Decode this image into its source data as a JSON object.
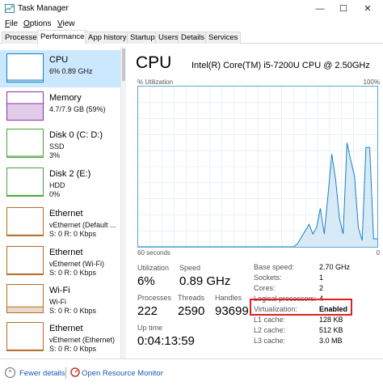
{
  "window": {
    "title": "Task Manager",
    "controls": {
      "minimize": "—",
      "maximize": "☐",
      "close": "✕"
    }
  },
  "menu": [
    {
      "hot": "F",
      "rest": "ile"
    },
    {
      "hot": "O",
      "rest": "ptions"
    },
    {
      "hot": "V",
      "rest": "iew"
    }
  ],
  "tabs": [
    "Processes",
    "Performance",
    "App history",
    "Startup",
    "Users",
    "Details",
    "Services"
  ],
  "active_tab": "Performance",
  "sidebar": [
    {
      "name": "CPU",
      "line1": "6%  0.89 GHz",
      "line2": "",
      "color": "#1581c3",
      "fill": 0.06
    },
    {
      "name": "Memory",
      "line1": "4.7/7.9 GB (59%)",
      "line2": "",
      "color": "#8b2fa8",
      "fill": 0.59
    },
    {
      "name": "Disk 0 (C: D:)",
      "line1": "SSD",
      "line2": "3%",
      "color": "#4aa33a",
      "fill": 0.03
    },
    {
      "name": "Disk 2 (E:)",
      "line1": "HDD",
      "line2": "0%",
      "color": "#4aa33a",
      "fill": 0.0
    },
    {
      "name": "Ethernet",
      "line1": "vEthernet (Default ...",
      "line2": "S: 0 R: 0 Kbps",
      "color": "#b36b27",
      "fill": 0.0
    },
    {
      "name": "Ethernet",
      "line1": "vEthernet (Wi-Fi)",
      "line2": "S: 0 R: 0 Kbps",
      "color": "#b36b27",
      "fill": 0.0
    },
    {
      "name": "Wi-Fi",
      "line1": "Wi-Fi",
      "line2": "S: 0 R: 0 Kbps",
      "color": "#b36b27",
      "fill": 0.2
    },
    {
      "name": "Ethernet",
      "line1": "vEthernet (Ethernet)",
      "line2": "S: 0 R: 0 Kbps",
      "color": "#b36b27",
      "fill": 0.0
    }
  ],
  "main": {
    "title": "CPU",
    "model": "Intel(R) Core(TM) i5-7200U CPU @ 2.50GHz",
    "util_label": "% Utilization",
    "util_max": "100%",
    "graph_left": "60 seconds",
    "graph_right": "0",
    "graph_color": "#1581c3",
    "utilization_series": [
      0,
      0,
      0,
      0,
      0,
      0,
      0,
      0,
      0,
      0,
      0,
      0,
      0,
      0,
      0,
      0,
      0,
      0,
      0,
      0,
      0,
      0,
      0,
      0,
      0,
      0,
      0,
      0,
      0,
      0,
      0,
      0,
      0,
      0,
      0,
      0,
      0,
      0,
      0,
      0,
      0,
      0,
      2,
      6,
      10,
      14,
      8,
      12,
      24,
      8,
      32,
      58,
      42,
      18,
      8,
      65,
      54,
      44,
      12,
      4,
      62,
      62,
      5,
      5
    ],
    "stats": {
      "utilization_label": "Utilization",
      "utilization": "6%",
      "speed_label": "Speed",
      "speed": "0.89 GHz",
      "processes_label": "Processes",
      "processes": "222",
      "threads_label": "Threads",
      "threads": "2590",
      "handles_label": "Handles",
      "handles": "93699",
      "uptime_label": "Up time",
      "uptime": "0:04:13:59"
    },
    "specs": [
      {
        "label": "Base speed:",
        "value": "2.70 GHz"
      },
      {
        "label": "Sockets:",
        "value": "1"
      },
      {
        "label": "Cores:",
        "value": "2"
      },
      {
        "label": "Logical processors:",
        "value": "4"
      },
      {
        "label": "Virtualization:",
        "value": "Enabled"
      },
      {
        "label": "L1 cache:",
        "value": "128 KB"
      },
      {
        "label": "L2 cache:",
        "value": "512 KB"
      },
      {
        "label": "L3 cache:",
        "value": "3.0 MB"
      }
    ]
  },
  "footer": {
    "fewer": "Fewer details",
    "monitor": "Open Resource Monitor"
  }
}
